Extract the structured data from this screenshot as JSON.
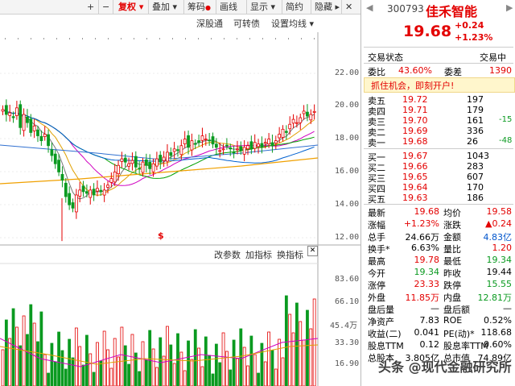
{
  "toolbar": {
    "plus": "+",
    "minus": "−",
    "fuquan": "复权",
    "diejia": "叠加",
    "chouma": "筹码",
    "huaxian": "画线",
    "xianshi": "显示",
    "jianyue": "简约",
    "yincang": "隐藏",
    "close": "✕"
  },
  "subtoolbar": {
    "shenguwang": "深股通",
    "kezhuanzhai": "可转债",
    "shezhi": "设置均线"
  },
  "indicator_bar": {
    "gaicanshu": "改参数",
    "jiazhibiao": "加指标",
    "huanzhibiao": "换指标"
  },
  "price_axis": [
    "22.00",
    "20.00",
    "18.00",
    "16.00",
    "14.00",
    "12.00"
  ],
  "volume_axis": [
    "83.60",
    "66.10",
    "45.4万",
    "33.30",
    "16.90"
  ],
  "stock": {
    "code": "300793",
    "name": "佳禾智能",
    "price": "19.68",
    "change": "+0.24",
    "change_pct": "+1.23%"
  },
  "status": {
    "trade_status_label": "交易状态",
    "trade_status_value": "交易中",
    "weibi_label": "委比",
    "weibi_value": "43.60%",
    "weicha_label": "委差",
    "weicha_value": "1390",
    "promo": "抓住机会，即刻开户!"
  },
  "sell_orders": [
    {
      "label": "卖五",
      "price": "19.72",
      "vol": "197",
      "delta": ""
    },
    {
      "label": "卖四",
      "price": "19.71",
      "vol": "179",
      "delta": ""
    },
    {
      "label": "卖三",
      "price": "19.70",
      "vol": "161",
      "delta": "-15"
    },
    {
      "label": "卖二",
      "price": "19.69",
      "vol": "336",
      "delta": ""
    },
    {
      "label": "卖一",
      "price": "19.68",
      "vol": "26",
      "delta": "-48"
    }
  ],
  "buy_orders": [
    {
      "label": "买一",
      "price": "19.67",
      "vol": "1043"
    },
    {
      "label": "买二",
      "price": "19.66",
      "vol": "283"
    },
    {
      "label": "买三",
      "price": "19.65",
      "vol": "607"
    },
    {
      "label": "买四",
      "price": "19.64",
      "vol": "170"
    },
    {
      "label": "买五",
      "price": "19.63",
      "vol": "186"
    }
  ],
  "stats": [
    {
      "l1": "最新",
      "v1": "19.68",
      "c1": "red",
      "l2": "均价",
      "v2": "19.58",
      "c2": "red"
    },
    {
      "l1": "涨幅",
      "v1": "+1.23%",
      "c1": "red",
      "l2": "涨跌",
      "v2": "▲0.24",
      "c2": "red"
    },
    {
      "l1": "总手",
      "v1": "24.66万",
      "c1": "",
      "l2": "金额",
      "v2": "4.83亿",
      "c2": "blue"
    },
    {
      "l1": "换手*",
      "v1": "6.63%",
      "c1": "",
      "l2": "量比",
      "v2": "1.20",
      "c2": "red"
    },
    {
      "l1": "最高",
      "v1": "19.78",
      "c1": "red",
      "l2": "最低",
      "v2": "19.34",
      "c2": "green"
    },
    {
      "l1": "今开",
      "v1": "19.34",
      "c1": "green",
      "l2": "昨收",
      "v2": "19.44",
      "c2": ""
    },
    {
      "l1": "涨停",
      "v1": "23.33",
      "c1": "red",
      "l2": "跌停",
      "v2": "15.55",
      "c2": "green"
    },
    {
      "l1": "外盘",
      "v1": "11.85万",
      "c1": "red",
      "l2": "内盘",
      "v2": "12.81万",
      "c2": "green"
    },
    {
      "l1": "盘后量",
      "v1": "—",
      "c1": "",
      "l2": "盘后额",
      "v2": "—",
      "c2": ""
    },
    {
      "l1": "净资产",
      "v1": "7.83",
      "c1": "",
      "l2": "ROE",
      "v2": "0.52%",
      "c2": ""
    },
    {
      "l1": "收益(二)",
      "v1": "0.041",
      "c1": "",
      "l2": "PE(动)*",
      "v2": "118.68",
      "c2": ""
    },
    {
      "l1": "股息TTM",
      "v1": "0.12",
      "c1": "",
      "l2": "股息率TTM",
      "v2": "0.60%",
      "c2": ""
    },
    {
      "l1": "总股本",
      "v1": "3.805亿",
      "c1": "",
      "l2": "总市值",
      "v2": "74.89亿",
      "c2": ""
    }
  ],
  "watermark": "头条 @现代金融研究所"
}
